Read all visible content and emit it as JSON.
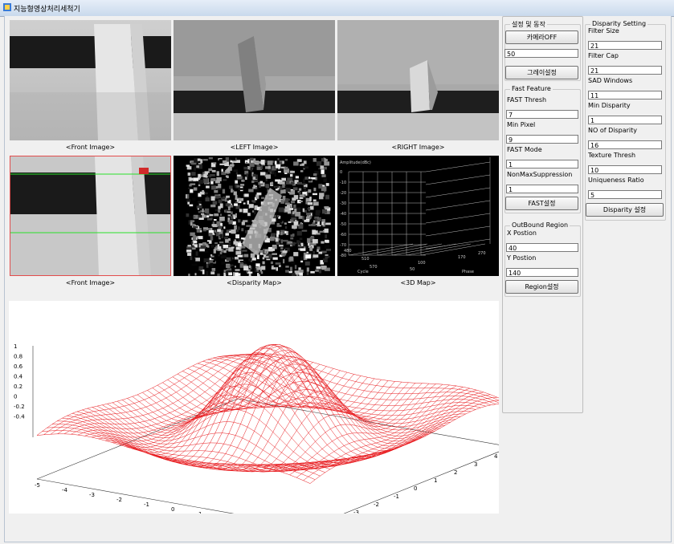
{
  "window": {
    "title": "지능형영상처리세척기"
  },
  "images": {
    "front1_caption": "<Front Image>",
    "left_caption": "<LEFT Image>",
    "right_caption": "<RIGHT Image>",
    "front2_caption": "<Front Image>",
    "disparity_caption": "<Disparity Map>",
    "map3d_caption": "<3D Map>",
    "map3d_header": "Amplitude(dBc)",
    "map3d_yticks": [
      "0",
      "-10",
      "-20",
      "-30",
      "-40",
      "-50",
      "-60",
      "-70",
      "-80"
    ],
    "map3d_xlabel": "Cycle",
    "map3d_zlabel": "Phase",
    "map3d_bottom_ticks": [
      "480",
      "510",
      "570",
      "50",
      "100",
      "170",
      "270"
    ]
  },
  "settings": {
    "group_title": "설정 및 동작",
    "camera_button": "카메라OFF",
    "gray_value": "50",
    "gray_button": "그레이설정"
  },
  "fast": {
    "group_title": "Fast Feature",
    "thresh_label": "FAST Thresh",
    "thresh_value": "7",
    "minpixel_label": "Min Pixel",
    "minpixel_value": "9",
    "mode_label": "FAST Mode",
    "mode_value": "1",
    "nonmax_label": "NonMaxSuppression",
    "nonmax_value": "1",
    "button": "FAST설정"
  },
  "outbound": {
    "group_title": "OutBound Region",
    "x_label": "X Postion",
    "x_value": "40",
    "y_label": "Y Postion",
    "y_value": "140",
    "button": "Region설정"
  },
  "disparity": {
    "group_title": "Disparity Setting",
    "filter_size_label": "Filter Size",
    "filter_size_value": "21",
    "filter_cap_label": "Filter Cap",
    "filter_cap_value": "21",
    "sad_label": "SAD Windows",
    "sad_value": "11",
    "min_disp_label": "Min Disparity",
    "min_disp_value": "1",
    "num_disp_label": "NO of Disparity",
    "num_disp_value": "16",
    "texture_label": "Texture Thresh",
    "texture_value": "10",
    "uniq_label": "Uniqueness Ratio",
    "uniq_value": "5",
    "button": "Disparity 설정"
  },
  "plot3d": {
    "z_ticks": [
      "1",
      "0.8",
      "0.6",
      "0.4",
      "0.2",
      "0",
      "-0.2",
      "-0.4"
    ],
    "x_ticks": [
      "-5",
      "-4",
      "-3",
      "-2",
      "-1",
      "0",
      "1",
      "2",
      "3",
      "4",
      "5"
    ],
    "y_ticks": [
      "-5",
      "-4",
      "-3",
      "-2",
      "-1",
      "0",
      "1",
      "2",
      "3",
      "4",
      "5"
    ],
    "surface_color": "#e8181c"
  }
}
